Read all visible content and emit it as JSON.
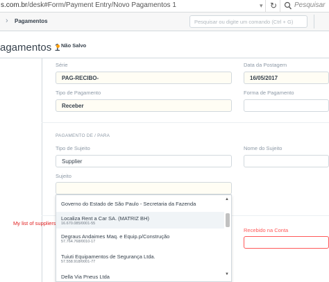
{
  "browser": {
    "url_prefix": "s.com.br",
    "url_path": "/desk#Form/Payment Entry/Novo Pagamentos 1",
    "search_placeholder": "Pesquisar"
  },
  "navbar": {
    "breadcrumb": "Pagamentos",
    "search_placeholder": "Pesquisar ou digite um comando (Ctrl + G)"
  },
  "page": {
    "title": "agamentos 1",
    "status": "Não Salvo"
  },
  "form": {
    "serie": {
      "label": "Série",
      "value": "PAG-RECIBO-"
    },
    "posting_date": {
      "label": "Data da Postagem",
      "value": "16/05/2017"
    },
    "payment_type": {
      "label": "Tipo de Pagamento",
      "value": "Receber"
    },
    "payment_method": {
      "label": "Forma de Pagamento",
      "value": ""
    },
    "party_section": {
      "title": "PAGAMENTO DE / PARA"
    },
    "party_type": {
      "label": "Tipo de Sujeito",
      "value": "Supplier"
    },
    "party_name": {
      "label": "Nome do Sujeito",
      "value": ""
    },
    "party": {
      "label": "Sujeito",
      "value": ""
    },
    "received_account": {
      "label": "Recebido na Conta",
      "value": ""
    }
  },
  "annotation": "My list of suppliers",
  "dropdown": {
    "items": [
      {
        "name": "Governo do Estado de São Paulo - Secretaria da Fazenda",
        "sub": ""
      },
      {
        "name": "Localiza Rent a Car SA. (MATRIZ BH)",
        "sub": "16.670.085/0001-55"
      },
      {
        "name": "Degraus Andaimes Maq. e Equip.p/Construção",
        "sub": "57.764.768/0010-17"
      },
      {
        "name": "Tuiuti Equipamentos de Segurança Ltda.",
        "sub": "57.558.918/0001-77"
      },
      {
        "name": "Della Via Pneus Ltda",
        "sub": ""
      }
    ]
  },
  "colors": {
    "required_bg": "#fffdf4",
    "indicator": "#ffa00a",
    "error": "#ff5858",
    "annotation": "#e02020"
  }
}
